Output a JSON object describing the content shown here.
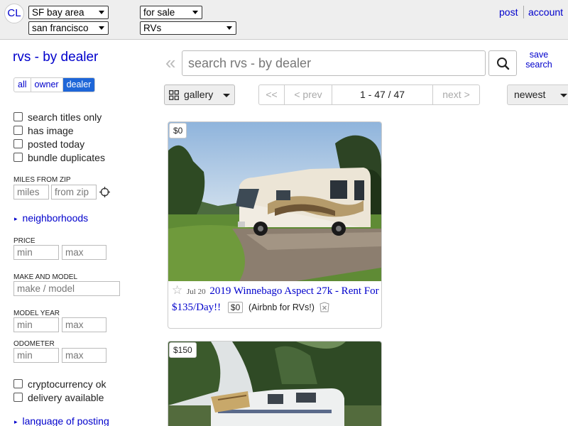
{
  "header": {
    "logo": "CL",
    "area": "SF bay area",
    "subarea": "san francisco",
    "section": "for sale",
    "category": "RVs",
    "post_label": "post",
    "account_label": "account"
  },
  "sidebar": {
    "title": "rvs - by dealer",
    "toggle": [
      "all",
      "owner",
      "dealer"
    ],
    "active_toggle": "dealer",
    "checkboxes_top": [
      "search titles only",
      "has image",
      "posted today",
      "bundle duplicates"
    ],
    "miles_label": "MILES FROM ZIP",
    "miles_placeholder": "miles",
    "zip_placeholder": "from zip",
    "neighborhoods_label": "neighborhoods",
    "price_label": "PRICE",
    "make_label": "MAKE AND MODEL",
    "make_placeholder": "make / model",
    "year_label": "MODEL YEAR",
    "odometer_label": "ODOMETER",
    "min_placeholder": "min",
    "max_placeholder": "max",
    "checkboxes_bottom": [
      "cryptocurrency ok",
      "delivery available"
    ],
    "language_label": "language of posting"
  },
  "search": {
    "placeholder": "search rvs - by dealer",
    "save_label": "save search"
  },
  "toolbar": {
    "view_label": "gallery",
    "pager": [
      "<<",
      "< prev",
      "1 - 47 / 47",
      "next >"
    ],
    "sort_label": "newest"
  },
  "listings": [
    {
      "price": "$0",
      "date": "Jul 20",
      "title": "2019 Winnebago Aspect 27k - Rent For $135/Day!!",
      "small_price": "$0",
      "hood": "(Airbnb for RVs!)"
    },
    {
      "price": "$150"
    }
  ]
}
